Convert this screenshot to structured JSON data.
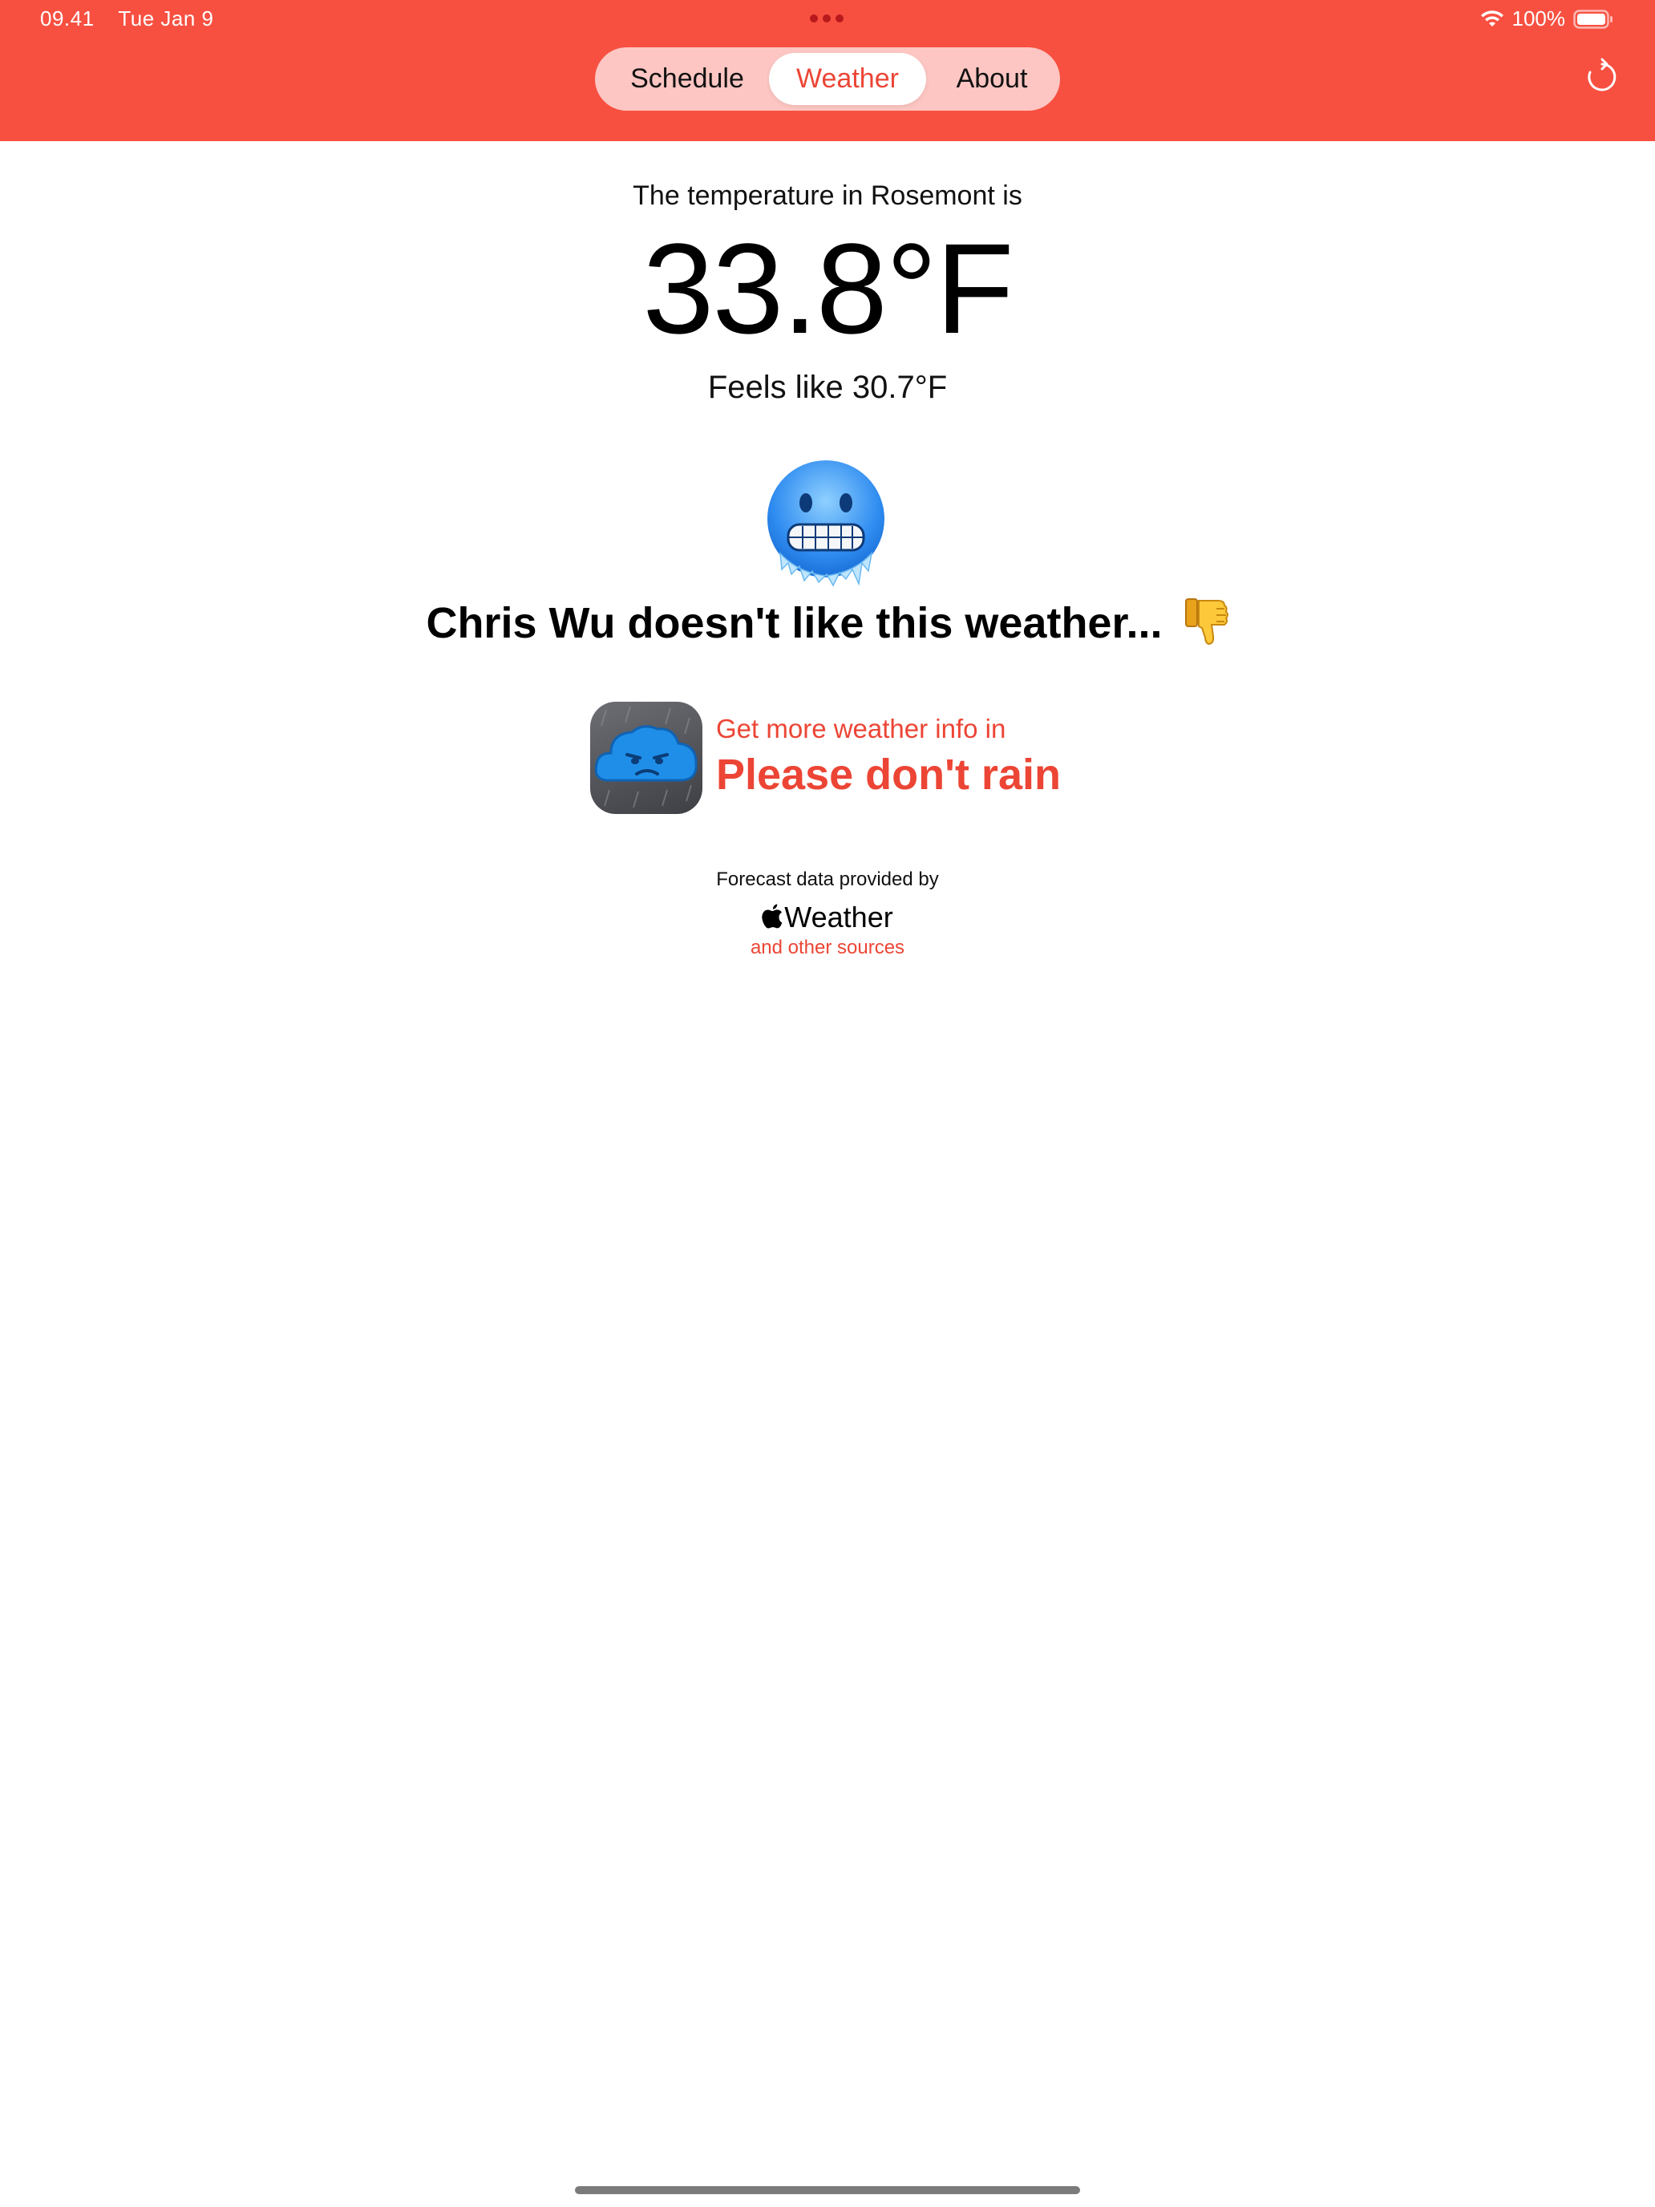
{
  "status_bar": {
    "time": "09.41",
    "date": "Tue Jan 9",
    "battery": "100%"
  },
  "tabs": [
    {
      "label": "Schedule",
      "selected": false
    },
    {
      "label": "Weather",
      "selected": true
    },
    {
      "label": "About",
      "selected": false
    }
  ],
  "weather": {
    "intro": "The temperature in Rosemont is",
    "temperature": "33.8°F",
    "feels_like": "Feels like 30.7°F",
    "emoji": "cold-face-icon",
    "verdict": "Chris Wu doesn't like this weather..."
  },
  "promo": {
    "line1": "Get more weather info in",
    "app_name": "Please don't rain"
  },
  "attribution": {
    "line": "Forecast data provided by",
    "provider": "Weather",
    "other_sources": "and other sources"
  },
  "colors": {
    "header": "#f75041",
    "accent": "#ec4535"
  }
}
